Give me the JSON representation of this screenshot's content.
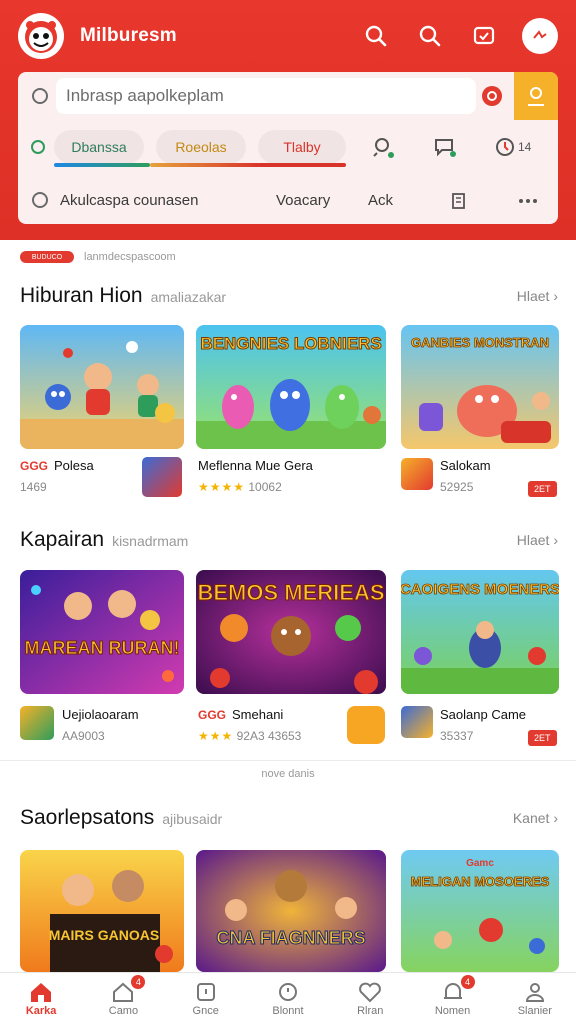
{
  "header": {
    "title": "Milburesm",
    "icons": [
      "search-icon",
      "search-icon",
      "message-icon",
      "avatar-icon"
    ]
  },
  "search": {
    "placeholder": "Inbrasp aapolkeplam"
  },
  "chips": [
    {
      "label": "Dbanssa",
      "color": "#2e7d5b",
      "bar": "#1e88e5"
    },
    {
      "label": "Roeolas",
      "color": "#c28a12",
      "bar": "#e6a23c"
    },
    {
      "label": "Tlalby",
      "color": "#d8342a",
      "bar": "#d8342a"
    }
  ],
  "chips_row": {
    "count": "14"
  },
  "filters": {
    "main": "Akulcaspa counasen",
    "option1": "Voacary",
    "option2": "Ack"
  },
  "promo": {
    "badge": "BUDUCO",
    "text": "lanmdecspascoom"
  },
  "sections": [
    {
      "title": "Hiburan Hion",
      "subtitle": "amaliazakar",
      "more": "Hlaet",
      "cards": [
        {
          "title": "Polesa",
          "prefix": "GGG",
          "meta": "1469",
          "art": "kids"
        },
        {
          "title": "Meflenna Mue Gera",
          "meta": "10062",
          "stars": "★★★★",
          "art": "bengnies",
          "banner": "BENGNIES LOBNIERS"
        },
        {
          "title": "Salokam",
          "meta": "52925",
          "tag": "2ET",
          "art": "ganbies",
          "banner": "GANBIES MONSTRAN"
        }
      ]
    },
    {
      "title": "Kapairan",
      "subtitle": "kisnadrmam",
      "more": "Hlaet",
      "cards": [
        {
          "title": "Uejiolaoaram",
          "meta": "AA9003",
          "art": "team",
          "banner": "MAREAN RURAN!"
        },
        {
          "title": "Smehani",
          "prefix": "GGG",
          "meta": "92A3 43653",
          "stars": "★★★",
          "art": "bemos",
          "banner": "BEMOS MERIEAS"
        },
        {
          "title": "Saolanp Came",
          "meta": "35337",
          "tag": "2ET",
          "art": "caoigens",
          "banner": "CAOIGENS MOENERS"
        }
      ]
    },
    {
      "title": "Saorlepsatons",
      "subtitle": "ajibusaidr",
      "more": "Kanet",
      "cards": [
        {
          "art": "mairs",
          "banner": "MAIRS GANOAS"
        },
        {
          "art": "cna",
          "banner": "CNA FIAGNNERS"
        },
        {
          "art": "meligan",
          "banner": "MELIGAN MOSOERES",
          "sub": "Gamc"
        }
      ]
    }
  ],
  "divider": {
    "label": "nove danis"
  },
  "nav": [
    {
      "label": "Karka",
      "icon": "home-icon",
      "active": true
    },
    {
      "label": "Camo",
      "icon": "house-outline-icon",
      "badge": "4"
    },
    {
      "label": "Gnce",
      "icon": "square-icon"
    },
    {
      "label": "Blonnt",
      "icon": "clock-icon"
    },
    {
      "label": "Rlran",
      "icon": "heart-icon"
    },
    {
      "label": "Nomen",
      "icon": "notification-icon",
      "badge": "4"
    },
    {
      "label": "Slanier",
      "icon": "user-icon"
    }
  ],
  "colors": {
    "brand": "#e23a2f",
    "accent": "#f6b12a"
  }
}
